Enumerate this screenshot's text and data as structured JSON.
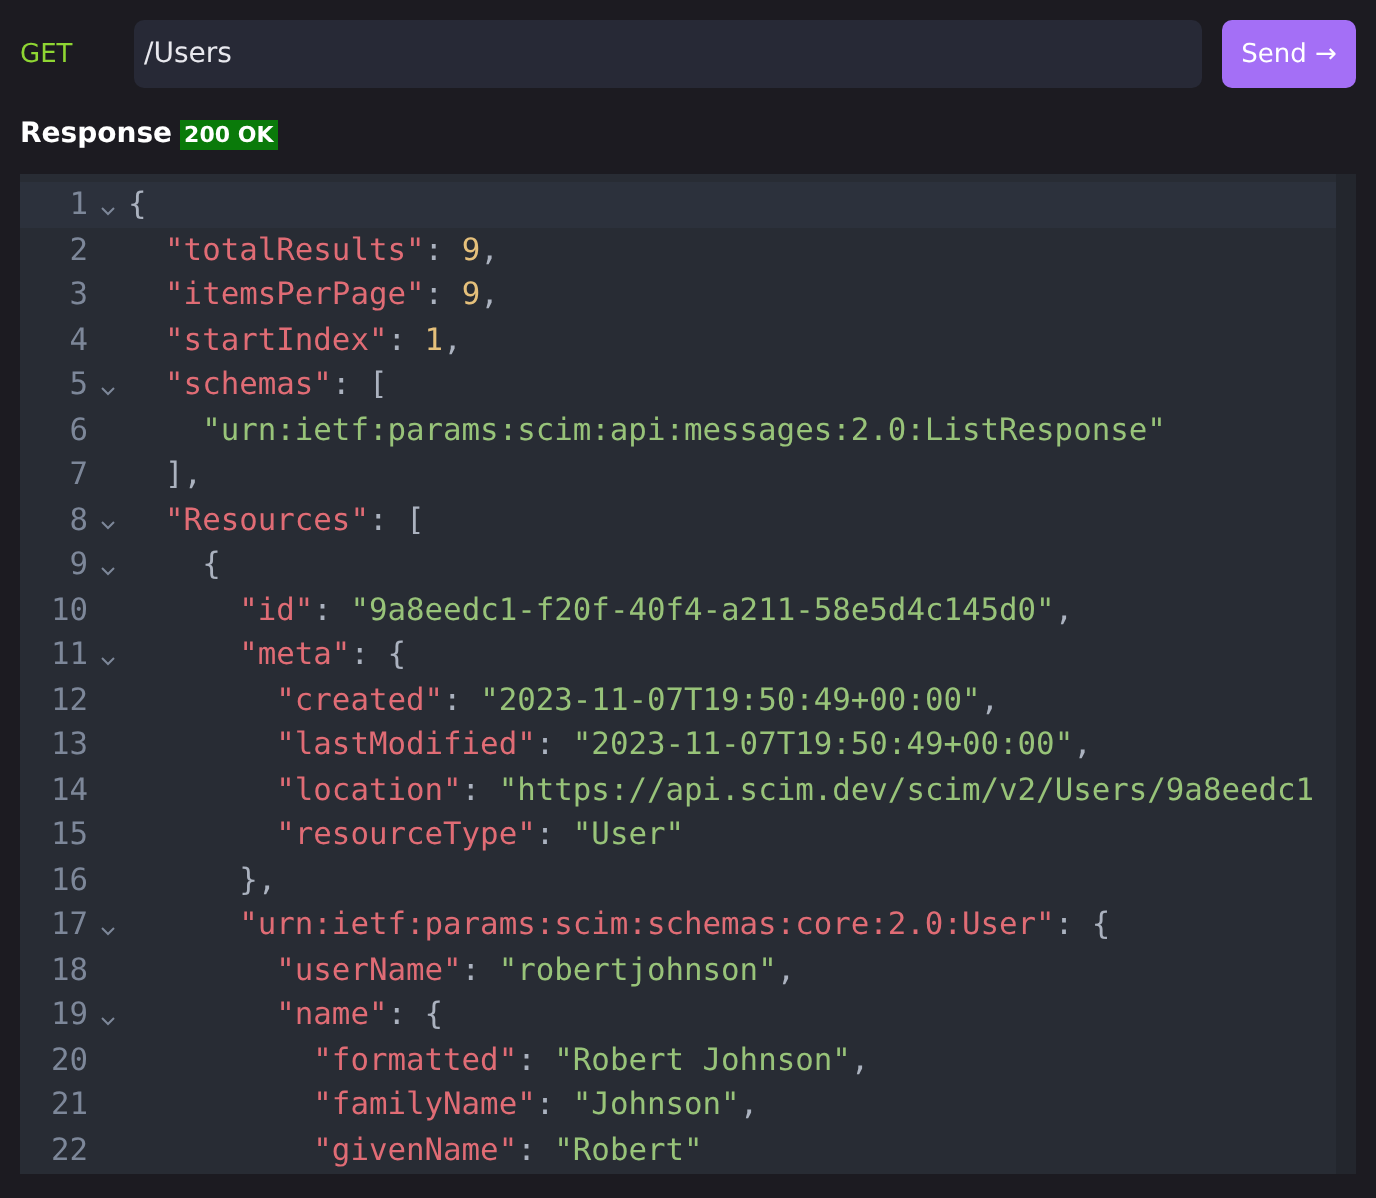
{
  "request": {
    "method": "GET",
    "path": "/Users",
    "send_label": "Send →"
  },
  "response": {
    "title": "Response",
    "status": "200 OK"
  },
  "editor": {
    "lines": [
      {
        "number": "1",
        "foldable": true,
        "active": true,
        "tokens": [
          {
            "kind": "punct",
            "text": "{"
          }
        ]
      },
      {
        "number": "2",
        "foldable": false,
        "active": false,
        "tokens": [
          {
            "kind": "key",
            "text": "  \"totalResults\""
          },
          {
            "kind": "punct",
            "text": ": "
          },
          {
            "kind": "number",
            "text": "9"
          },
          {
            "kind": "punct",
            "text": ","
          }
        ]
      },
      {
        "number": "3",
        "foldable": false,
        "active": false,
        "tokens": [
          {
            "kind": "key",
            "text": "  \"itemsPerPage\""
          },
          {
            "kind": "punct",
            "text": ": "
          },
          {
            "kind": "number",
            "text": "9"
          },
          {
            "kind": "punct",
            "text": ","
          }
        ]
      },
      {
        "number": "4",
        "foldable": false,
        "active": false,
        "tokens": [
          {
            "kind": "key",
            "text": "  \"startIndex\""
          },
          {
            "kind": "punct",
            "text": ": "
          },
          {
            "kind": "number",
            "text": "1"
          },
          {
            "kind": "punct",
            "text": ","
          }
        ]
      },
      {
        "number": "5",
        "foldable": true,
        "active": false,
        "tokens": [
          {
            "kind": "key",
            "text": "  \"schemas\""
          },
          {
            "kind": "punct",
            "text": ": ["
          }
        ]
      },
      {
        "number": "6",
        "foldable": false,
        "active": false,
        "tokens": [
          {
            "kind": "string",
            "text": "    \"urn:ietf:params:scim:api:messages:2.0:ListResponse\""
          }
        ]
      },
      {
        "number": "7",
        "foldable": false,
        "active": false,
        "tokens": [
          {
            "kind": "punct",
            "text": "  ],"
          }
        ]
      },
      {
        "number": "8",
        "foldable": true,
        "active": false,
        "tokens": [
          {
            "kind": "key",
            "text": "  \"Resources\""
          },
          {
            "kind": "punct",
            "text": ": ["
          }
        ]
      },
      {
        "number": "9",
        "foldable": true,
        "active": false,
        "tokens": [
          {
            "kind": "punct",
            "text": "    {"
          }
        ]
      },
      {
        "number": "10",
        "foldable": false,
        "active": false,
        "tokens": [
          {
            "kind": "key",
            "text": "      \"id\""
          },
          {
            "kind": "punct",
            "text": ": "
          },
          {
            "kind": "string",
            "text": "\"9a8eedc1-f20f-40f4-a211-58e5d4c145d0\""
          },
          {
            "kind": "punct",
            "text": ","
          }
        ]
      },
      {
        "number": "11",
        "foldable": true,
        "active": false,
        "tokens": [
          {
            "kind": "key",
            "text": "      \"meta\""
          },
          {
            "kind": "punct",
            "text": ": {"
          }
        ]
      },
      {
        "number": "12",
        "foldable": false,
        "active": false,
        "tokens": [
          {
            "kind": "key",
            "text": "        \"created\""
          },
          {
            "kind": "punct",
            "text": ": "
          },
          {
            "kind": "string",
            "text": "\"2023-11-07T19:50:49+00:00\""
          },
          {
            "kind": "punct",
            "text": ","
          }
        ]
      },
      {
        "number": "13",
        "foldable": false,
        "active": false,
        "tokens": [
          {
            "kind": "key",
            "text": "        \"lastModified\""
          },
          {
            "kind": "punct",
            "text": ": "
          },
          {
            "kind": "string",
            "text": "\"2023-11-07T19:50:49+00:00\""
          },
          {
            "kind": "punct",
            "text": ","
          }
        ]
      },
      {
        "number": "14",
        "foldable": false,
        "active": false,
        "tokens": [
          {
            "kind": "key",
            "text": "        \"location\""
          },
          {
            "kind": "punct",
            "text": ": "
          },
          {
            "kind": "string",
            "text": "\"https://api.scim.dev/scim/v2/Users/9a8eedc1"
          }
        ]
      },
      {
        "number": "15",
        "foldable": false,
        "active": false,
        "tokens": [
          {
            "kind": "key",
            "text": "        \"resourceType\""
          },
          {
            "kind": "punct",
            "text": ": "
          },
          {
            "kind": "string",
            "text": "\"User\""
          }
        ]
      },
      {
        "number": "16",
        "foldable": false,
        "active": false,
        "tokens": [
          {
            "kind": "punct",
            "text": "      },"
          }
        ]
      },
      {
        "number": "17",
        "foldable": true,
        "active": false,
        "tokens": [
          {
            "kind": "key",
            "text": "      \"urn:ietf:params:scim:schemas:core:2.0:User\""
          },
          {
            "kind": "punct",
            "text": ": {"
          }
        ]
      },
      {
        "number": "18",
        "foldable": false,
        "active": false,
        "tokens": [
          {
            "kind": "key",
            "text": "        \"userName\""
          },
          {
            "kind": "punct",
            "text": ": "
          },
          {
            "kind": "string",
            "text": "\"robertjohnson\""
          },
          {
            "kind": "punct",
            "text": ","
          }
        ]
      },
      {
        "number": "19",
        "foldable": true,
        "active": false,
        "tokens": [
          {
            "kind": "key",
            "text": "        \"name\""
          },
          {
            "kind": "punct",
            "text": ": {"
          }
        ]
      },
      {
        "number": "20",
        "foldable": false,
        "active": false,
        "tokens": [
          {
            "kind": "key",
            "text": "          \"formatted\""
          },
          {
            "kind": "punct",
            "text": ": "
          },
          {
            "kind": "string",
            "text": "\"Robert Johnson\""
          },
          {
            "kind": "punct",
            "text": ","
          }
        ]
      },
      {
        "number": "21",
        "foldable": false,
        "active": false,
        "tokens": [
          {
            "kind": "key",
            "text": "          \"familyName\""
          },
          {
            "kind": "punct",
            "text": ": "
          },
          {
            "kind": "string",
            "text": "\"Johnson\""
          },
          {
            "kind": "punct",
            "text": ","
          }
        ]
      },
      {
        "number": "22",
        "foldable": false,
        "active": false,
        "tokens": [
          {
            "kind": "key",
            "text": "          \"givenName\""
          },
          {
            "kind": "punct",
            "text": ": "
          },
          {
            "kind": "string",
            "text": "\"Robert\""
          }
        ]
      }
    ]
  }
}
